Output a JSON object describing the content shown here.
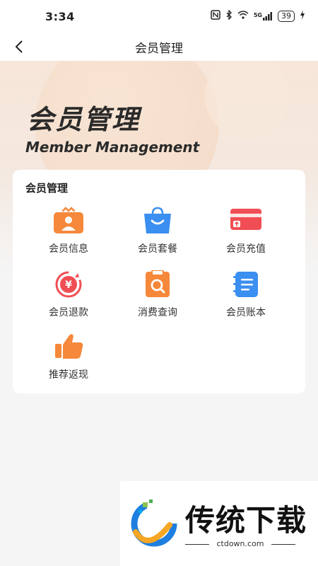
{
  "status_bar": {
    "time": "3:34",
    "battery": "39",
    "network": "5G"
  },
  "nav": {
    "title": "会员管理"
  },
  "hero": {
    "title_cn": "会员管理",
    "title_en": "Member Management"
  },
  "card": {
    "title": "会员管理",
    "items": [
      {
        "label": "会员信息",
        "icon": "member-info-icon"
      },
      {
        "label": "会员套餐",
        "icon": "member-package-icon"
      },
      {
        "label": "会员充值",
        "icon": "member-recharge-icon"
      },
      {
        "label": "会员退款",
        "icon": "member-refund-icon"
      },
      {
        "label": "消费查询",
        "icon": "consumption-query-icon"
      },
      {
        "label": "会员账本",
        "icon": "member-ledger-icon"
      },
      {
        "label": "推荐返现",
        "icon": "referral-cashback-icon"
      }
    ]
  },
  "watermark": {
    "brand": "传统下载",
    "url": "ctdown.com"
  },
  "colors": {
    "orange": "#f5883a",
    "blue": "#3b8ff0",
    "red": "#f04e54"
  }
}
